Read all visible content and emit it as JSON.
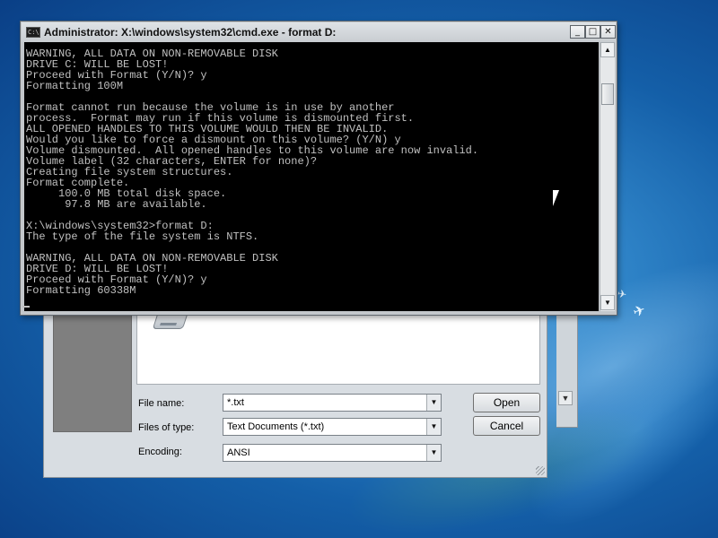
{
  "console": {
    "title": "Administrator: X:\\windows\\system32\\cmd.exe - format  D:",
    "icon_text": "C:\\",
    "controls": {
      "minimize": "_",
      "maximize": "□",
      "close": "✕"
    },
    "output": "WARNING, ALL DATA ON NON-REMOVABLE DISK\nDRIVE C: WILL BE LOST!\nProceed with Format (Y/N)? y\nFormatting 100M\n\nFormat cannot run because the volume is in use by another\nprocess.  Format may run if this volume is dismounted first.\nALL OPENED HANDLES TO THIS VOLUME WOULD THEN BE INVALID.\nWould you like to force a dismount on this volume? (Y/N) y\nVolume dismounted.  All opened handles to this volume are now invalid.\nVolume label (32 characters, ENTER for none)?\nCreating file system structures.\nFormat complete.\n     100.0 MB total disk space.\n      97.8 MB are available.\n\nX:\\windows\\system32>format D:\nThe type of the file system is NTFS.\n\nWARNING, ALL DATA ON NON-REMOVABLE DISK\nDRIVE D: WILL BE LOST!\nProceed with Format (Y/N)? y\nFormatting 60338M",
    "scrollbar": {
      "up_arrow": "▲",
      "down_arrow": "▼"
    }
  },
  "dialog": {
    "file_name": {
      "label": "File name:",
      "value": "*.txt"
    },
    "files_of_type": {
      "label": "Files of type:",
      "value": "Text Documents (*.txt)"
    },
    "encoding": {
      "label": "Encoding:",
      "value": "ANSI"
    },
    "combo_arrow": "▼",
    "open_label": "Open",
    "cancel_label": "Cancel"
  },
  "background_window": {
    "scroll_down_arrow": "▼"
  },
  "desktop": {
    "bird_glyph": "✈"
  }
}
